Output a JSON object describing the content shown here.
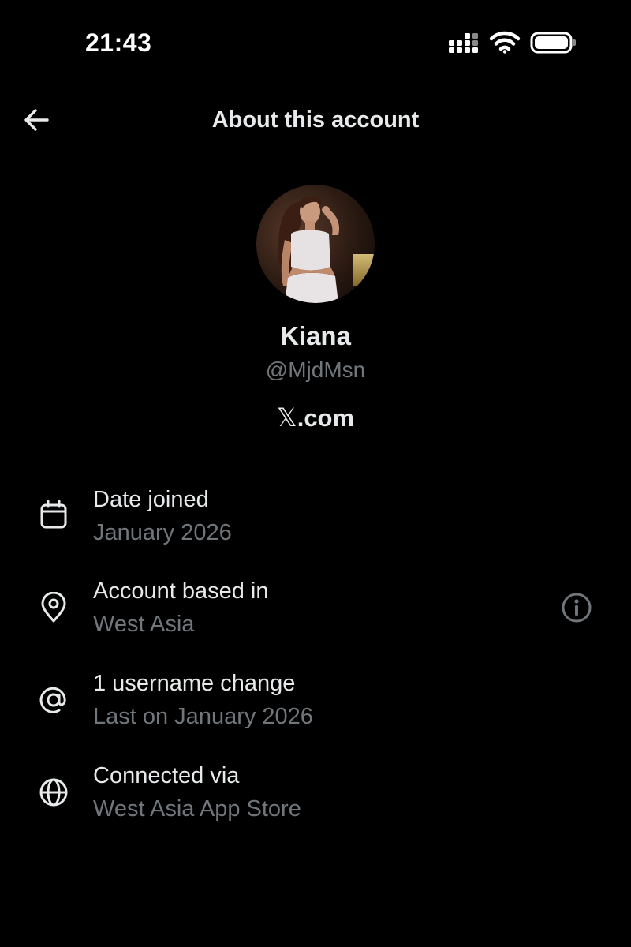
{
  "status_bar": {
    "time": "21:43",
    "icons": [
      "signal-icon",
      "wifi-icon",
      "battery-icon"
    ]
  },
  "header": {
    "title": "About this account",
    "back_icon": "arrow-left-icon"
  },
  "profile": {
    "name": "Kiana",
    "handle": "@MjdMsn",
    "source_glyph": "𝕏",
    "source_text": ".com"
  },
  "info_rows": [
    {
      "icon": "calendar-icon",
      "title": "Date joined",
      "value": "January 2026"
    },
    {
      "icon": "location-pin-icon",
      "title": "Account based in",
      "value": "West Asia",
      "trailing_icon": "info-icon"
    },
    {
      "icon": "at-sign-icon",
      "title": "1 username change",
      "value": "Last on January 2026"
    },
    {
      "icon": "globe-icon",
      "title": "Connected via",
      "value": "West Asia App Store"
    }
  ],
  "colors": {
    "background": "#000000",
    "primary_text": "#e7e9ea",
    "secondary_text": "#71767b"
  }
}
